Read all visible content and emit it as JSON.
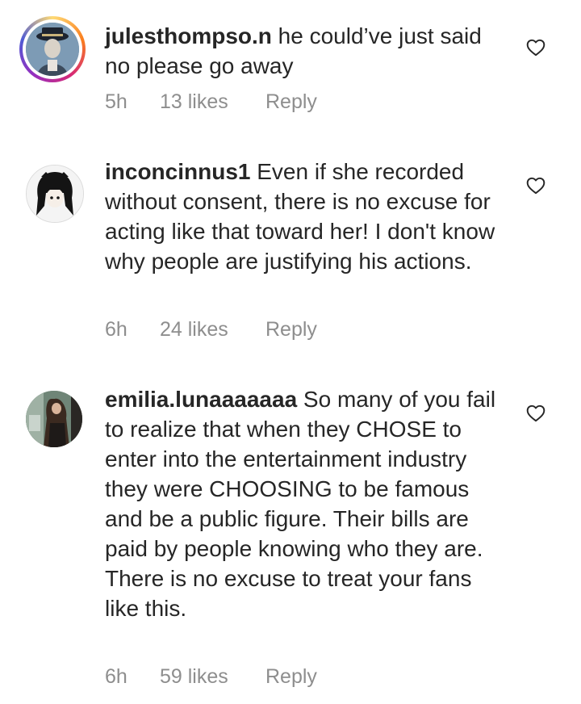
{
  "comments": [
    {
      "username": "julesthompso.n",
      "text": " he could’ve just said no please go away",
      "time": "5h",
      "likes": "13 likes",
      "reply": "Reply"
    },
    {
      "username": "inconcinnus1",
      "text": " Even if she recorded without consent, there is no excuse for acting like that toward her! I don't know why people are justifying his actions.",
      "time": "6h",
      "likes": "24 likes",
      "reply": "Reply"
    },
    {
      "username": "emilia.lunaaaaaaa",
      "text": " So many of you fail to realize that when they CHOSE to enter into the entertainment industry they were CHOOSING to be famous and be a public figure. Their bills are paid by people knowing who they are. There is no excuse to treat your fans like this.",
      "time": "6h",
      "likes": "59 likes",
      "reply": "Reply"
    }
  ],
  "icons": {
    "like": "heart-outline-icon"
  },
  "colors": {
    "text": "#262626",
    "meta": "#8e8e8e",
    "story_ring": "#d62976"
  }
}
